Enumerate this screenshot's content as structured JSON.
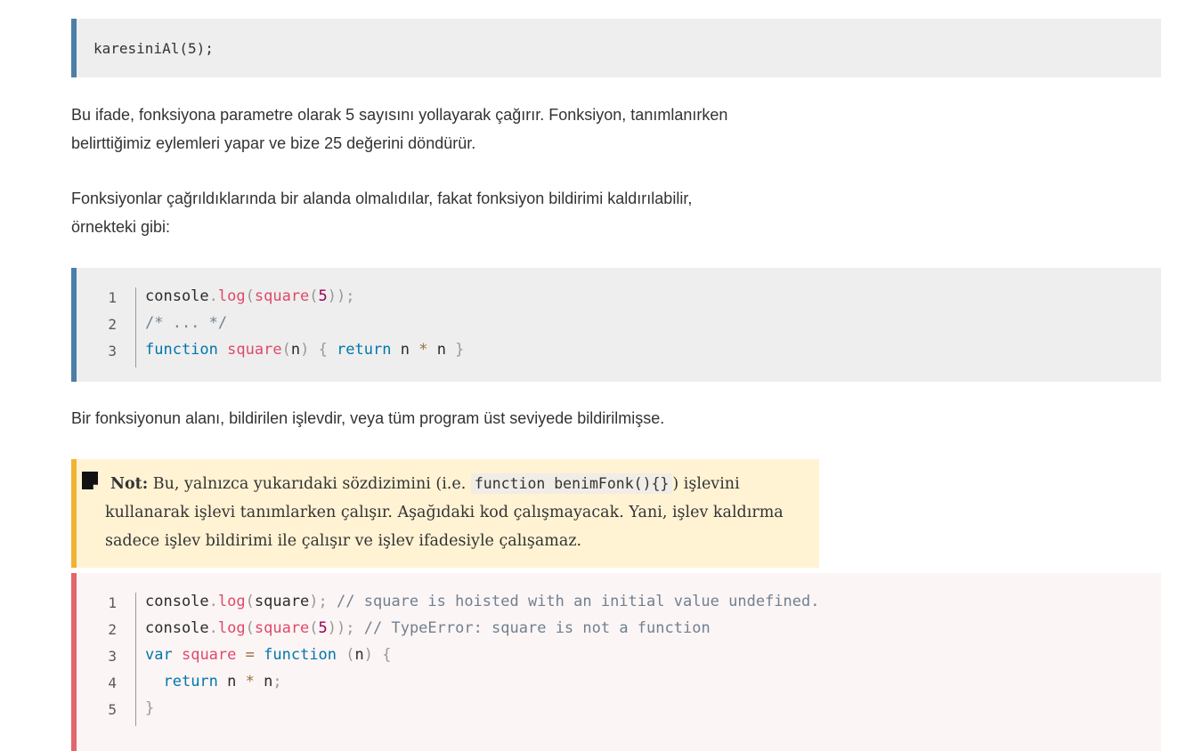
{
  "snippet1": {
    "code": "karesiniAl(5);"
  },
  "para1": {
    "line1": "Bu ifade, fonksiyona parametre olarak 5 sayısını yollayarak çağırır. Fonksiyon, tanımlanırken",
    "line2": "belirttiğimiz eylemleri yapar ve bize 25 değerini döndürür."
  },
  "para2": {
    "line1": "Fonksiyonlar çağrıldıklarında bir alanda olmalıdılar, fakat fonksiyon bildirimi kaldırılabilir,",
    "line2": "örnekteki gibi:"
  },
  "codeblock1": {
    "lines": [
      {
        "num": "1",
        "tokens": [
          [
            "plain",
            "console"
          ],
          [
            "punct",
            "."
          ],
          [
            "fn",
            "log"
          ],
          [
            "punct",
            "("
          ],
          [
            "fn",
            "square"
          ],
          [
            "punct",
            "("
          ],
          [
            "num",
            "5"
          ],
          [
            "punct",
            "));"
          ]
        ]
      },
      {
        "num": "2",
        "tokens": [
          [
            "comment",
            "/* ... */"
          ]
        ]
      },
      {
        "num": "3",
        "tokens": [
          [
            "kw",
            "function"
          ],
          [
            "plain",
            " "
          ],
          [
            "fn",
            "square"
          ],
          [
            "punct",
            "("
          ],
          [
            "plain",
            "n"
          ],
          [
            "punct",
            ")"
          ],
          [
            "plain",
            " "
          ],
          [
            "punct",
            "{"
          ],
          [
            "plain",
            " "
          ],
          [
            "kw",
            "return"
          ],
          [
            "plain",
            " n "
          ],
          [
            "op",
            "*"
          ],
          [
            "plain",
            " n "
          ],
          [
            "punct",
            "}"
          ]
        ]
      }
    ]
  },
  "para3": {
    "text": "Bir fonksiyonun alanı, bildirilen işlevdir, veya tüm program üst seviyede bildirilmişse."
  },
  "note": {
    "label": "Not:",
    "text_before": " Bu, yalnızca yukarıdaki sözdizimini (i.e. ",
    "code": "function benimFonk(){}",
    "text_after": ") işlevini",
    "line2": "kullanarak işlevi tanımlarken çalışır. Aşağıdaki kod çalışmayacak. Yani, işlev kaldırma",
    "line3": "sadece işlev bildirimi ile çalışır ve işlev ifadesiyle çalışamaz.",
    "icon": "note-icon"
  },
  "codeblock2": {
    "lines": [
      {
        "num": "1",
        "tokens": [
          [
            "plain",
            "console"
          ],
          [
            "punct",
            "."
          ],
          [
            "fn",
            "log"
          ],
          [
            "punct",
            "("
          ],
          [
            "plain",
            "square"
          ],
          [
            "punct",
            ");"
          ],
          [
            "plain",
            " "
          ],
          [
            "comment",
            "// square is hoisted with an initial value undefined."
          ]
        ]
      },
      {
        "num": "2",
        "tokens": [
          [
            "plain",
            "console"
          ],
          [
            "punct",
            "."
          ],
          [
            "fn",
            "log"
          ],
          [
            "punct",
            "("
          ],
          [
            "fn",
            "square"
          ],
          [
            "punct",
            "("
          ],
          [
            "num",
            "5"
          ],
          [
            "punct",
            "));"
          ],
          [
            "plain",
            " "
          ],
          [
            "comment",
            "// TypeError: square is not a function"
          ]
        ]
      },
      {
        "num": "3",
        "tokens": [
          [
            "kw",
            "var"
          ],
          [
            "plain",
            " "
          ],
          [
            "fn",
            "square"
          ],
          [
            "plain",
            " "
          ],
          [
            "op",
            "="
          ],
          [
            "plain",
            " "
          ],
          [
            "kw",
            "function"
          ],
          [
            "plain",
            " "
          ],
          [
            "punct",
            "("
          ],
          [
            "plain",
            "n"
          ],
          [
            "punct",
            ")"
          ],
          [
            "plain",
            " "
          ],
          [
            "punct",
            "{"
          ]
        ]
      },
      {
        "num": "4",
        "tokens": [
          [
            "plain",
            "  "
          ],
          [
            "kw",
            "return"
          ],
          [
            "plain",
            " n "
          ],
          [
            "op",
            "*"
          ],
          [
            "plain",
            " n"
          ],
          [
            "punct",
            ";"
          ]
        ]
      },
      {
        "num": "5",
        "tokens": [
          [
            "punct",
            "}"
          ]
        ]
      }
    ]
  },
  "colors": {
    "accent_blue": "#4d7ea8",
    "accent_red": "#e0676b",
    "note_yellow": "#f2b233"
  }
}
